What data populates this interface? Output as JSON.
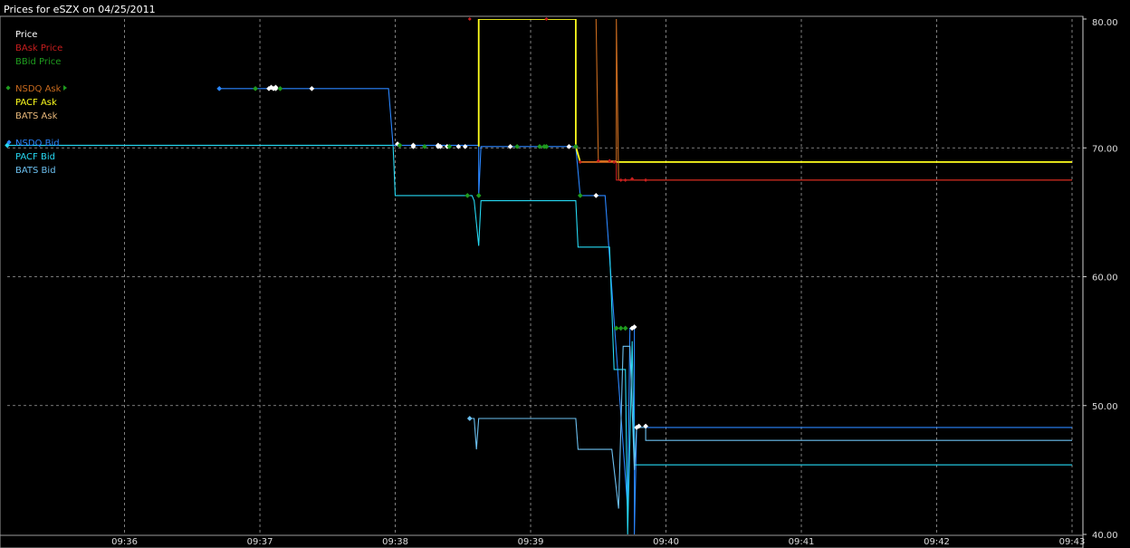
{
  "window": {
    "title": "Prices for  eSZX  on  04/25/2011"
  },
  "chart_data": {
    "type": "line",
    "title": "Prices for  eSZX  on  04/25/2011",
    "xlabel": "",
    "ylabel": "",
    "x_ticks": [
      "09:36",
      "09:37",
      "09:38",
      "09:39",
      "09:40",
      "09:41",
      "09:42",
      "09:43"
    ],
    "y_ticks": [
      40,
      50,
      60,
      70,
      80
    ],
    "y_tick_labels": [
      "40.00",
      "50.00",
      "60.00",
      "70.00",
      "80.00"
    ],
    "xlim": [
      "09:35:08",
      "09:43:00"
    ],
    "ylim": [
      40,
      80
    ],
    "grid": true,
    "legend_position": "top-left",
    "legend": [
      {
        "label": "Price",
        "color": "#ffffff",
        "key": "price"
      },
      {
        "label": "BAsk Price",
        "color": "#c81e1e",
        "key": "bask"
      },
      {
        "label": "BBid Price",
        "color": "#1e9a1e",
        "key": "bbid"
      },
      {
        "label": "NSDQ Ask",
        "color": "#c86a1e",
        "key": "nsdq_ask"
      },
      {
        "label": "PACF Ask",
        "color": "#ffff1e",
        "key": "pacf_ask"
      },
      {
        "label": "BATS Ask",
        "color": "#e8b87a",
        "key": "bats_ask"
      },
      {
        "label": "NSDQ Bid",
        "color": "#2a86ff",
        "key": "nsdq_bid"
      },
      {
        "label": "PACF Bid",
        "color": "#26d8f2",
        "key": "pacf_bid"
      },
      {
        "label": "BATS Bid",
        "color": "#6cc0f0",
        "key": "bats_bid"
      }
    ],
    "series": [
      {
        "name": "NSDQ Bid",
        "color": "#2a86ff",
        "x": [
          "09:36:42",
          "09:37:57",
          "09:37:59",
          "09:38:37",
          "09:38:37",
          "09:38:38",
          "09:39:20",
          "09:39:22",
          "09:39:33",
          "09:39:43",
          "09:39:44",
          "09:39:46",
          "09:39:46",
          "09:39:47",
          "09:39:50",
          "09:43:00"
        ],
        "y": [
          74.6,
          74.6,
          70.2,
          70.2,
          66.3,
          70.1,
          70.1,
          66.3,
          66.3,
          42.0,
          56.0,
          56.0,
          40.0,
          48.3,
          48.3,
          48.3
        ]
      },
      {
        "name": "PACF Bid",
        "color": "#26d8f2",
        "x": [
          "09:35:08",
          "09:37:59",
          "09:38:00",
          "09:38:34",
          "09:38:35",
          "09:38:37",
          "09:38:38",
          "09:38:38",
          "09:39:20",
          "09:39:21",
          "09:39:35",
          "09:39:37",
          "09:39:42",
          "09:39:43",
          "09:39:45",
          "09:39:46",
          "09:43:00"
        ],
        "y": [
          70.2,
          70.2,
          66.3,
          66.3,
          65.9,
          62.4,
          65.9,
          65.9,
          65.9,
          62.3,
          62.3,
          52.8,
          52.8,
          40.0,
          55.0,
          45.4,
          45.4
        ]
      },
      {
        "name": "BATS Bid",
        "color": "#6cc0f0",
        "x": [
          "09:38:33",
          "09:38:35",
          "09:38:36",
          "09:38:37",
          "09:38:38",
          "09:39:20",
          "09:39:21",
          "09:39:36",
          "09:39:39",
          "09:39:41",
          "09:39:44",
          "09:39:46",
          "09:39:47",
          "09:39:51",
          "09:39:51",
          "09:43:00"
        ],
        "y": [
          49.0,
          49.0,
          46.6,
          49.0,
          49.0,
          49.0,
          46.6,
          46.6,
          42.0,
          54.6,
          54.6,
          45.0,
          48.3,
          48.3,
          47.3,
          47.3
        ]
      },
      {
        "name": "PACF Ask",
        "color": "#ffff1e",
        "x": [
          "09:38:37",
          "09:38:37",
          "09:39:20",
          "09:39:20",
          "09:39:22",
          "09:43:00"
        ],
        "y": [
          70.1,
          80.0,
          80.0,
          70.1,
          68.9,
          68.9
        ]
      },
      {
        "name": "NSDQ Ask",
        "color": "#c86a1e",
        "x": [
          "09:39:29",
          "09:39:29",
          "09:39:30",
          "09:39:38",
          "09:39:38",
          "09:39:39",
          "09:43:00"
        ],
        "y": [
          80.0,
          80.0,
          69.0,
          69.0,
          80.0,
          67.5,
          67.5
        ]
      },
      {
        "name": "BAsk Price",
        "color": "#c81e1e",
        "x": [
          "09:39:22",
          "09:39:38",
          "09:39:38",
          "09:43:00"
        ],
        "y": [
          68.9,
          68.9,
          67.5,
          67.5
        ]
      }
    ],
    "markers": [
      {
        "series": "NSDQ Bid",
        "color": "#2a86ff",
        "x": [
          "09:36:42"
        ],
        "y": [
          74.6
        ]
      },
      {
        "series": "PACF Bid",
        "color": "#26d8f2",
        "x": [
          "09:35:08"
        ],
        "y": [
          70.2
        ]
      },
      {
        "series": "BATS Bid",
        "color": "#6cc0f0",
        "x": [
          "09:38:33"
        ],
        "y": [
          49.0
        ]
      },
      {
        "series": "Price",
        "color": "#ffffff",
        "x": [
          "09:37:04",
          "09:37:05",
          "09:37:06",
          "09:37:07",
          "09:37:07",
          "09:37:23",
          "09:38:01",
          "09:38:08",
          "09:38:08",
          "09:38:19",
          "09:38:19",
          "09:38:20",
          "09:38:23",
          "09:38:28",
          "09:38:31",
          "09:38:51",
          "09:39:17",
          "09:39:20",
          "09:39:29",
          "09:39:45",
          "09:39:46",
          "09:39:47",
          "09:39:48",
          "09:39:51"
        ],
        "y": [
          74.6,
          74.7,
          74.6,
          74.7,
          74.6,
          74.6,
          70.3,
          70.2,
          70.1,
          70.1,
          70.2,
          70.1,
          70.1,
          70.1,
          70.1,
          70.1,
          70.1,
          70.1,
          66.3,
          56.0,
          56.1,
          48.3,
          48.4,
          48.4
        ]
      },
      {
        "series": "BBid Price",
        "color": "#1e9a1e",
        "x": [
          "09:36:58",
          "09:37:09",
          "09:38:02",
          "09:38:13",
          "09:38:24",
          "09:38:32",
          "09:38:37",
          "09:38:54",
          "09:39:04",
          "09:39:06",
          "09:39:07",
          "09:39:20",
          "09:39:22",
          "09:39:38",
          "09:39:40",
          "09:39:42"
        ],
        "y": [
          74.6,
          74.6,
          70.2,
          70.1,
          70.1,
          66.3,
          66.3,
          70.1,
          70.1,
          70.1,
          70.1,
          70.1,
          66.3,
          56.0,
          56.0,
          56.0
        ]
      },
      {
        "series": "BAsk Price",
        "color": "#c81e1e",
        "x": [
          "09:38:33",
          "09:39:07",
          "09:39:22",
          "09:39:30",
          "09:39:35",
          "09:39:37",
          "09:39:40",
          "09:39:42",
          "09:39:45",
          "09:39:51"
        ],
        "y": [
          80.0,
          80.0,
          68.9,
          69.0,
          69.0,
          68.9,
          67.5,
          67.5,
          67.6,
          67.5
        ]
      }
    ]
  }
}
